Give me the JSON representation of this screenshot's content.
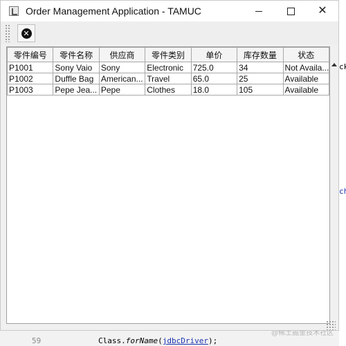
{
  "window": {
    "title": "Order Management Application - TAMUC",
    "minimize_icon": "minimize-icon",
    "maximize_icon": "maximize-icon",
    "close_icon": "close-icon",
    "close_glyph": "✕"
  },
  "toolbar": {
    "cancel_icon": "cancel-circle-icon",
    "cancel_glyph": "✕"
  },
  "table": {
    "columns": [
      "零件编号",
      "零件名称",
      "供应商",
      "零件类别",
      "单价",
      "库存数量",
      "状态"
    ],
    "rows": [
      [
        "P1001",
        "Sony Vaio",
        "Sony",
        "Electronic",
        "725.0",
        "34",
        "Not Availa..."
      ],
      [
        "P1002",
        "Duffle Bag",
        "American...",
        "Travel",
        "65.0",
        "25",
        "Available"
      ],
      [
        "P1003",
        "Pepe Jea...",
        "Pepe",
        "Clothes",
        "18.0",
        "105",
        "Available"
      ]
    ]
  },
  "background": {
    "line_number": "59",
    "code_prefix": "Class.",
    "code_method": "forName",
    "code_arg": "jdbcDriver",
    "code_suffix": ");",
    "right_fragment_top": "ck",
    "right_fragment_mid": "ch",
    "watermark": "@稀土掘金技术社区"
  }
}
